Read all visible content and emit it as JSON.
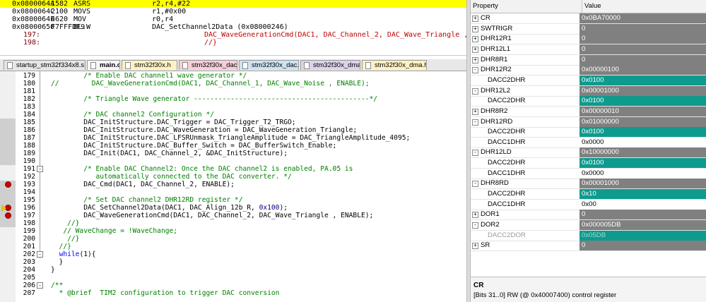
{
  "disassembly": [
    {
      "addr": "0x0800064A",
      "hex": "1582",
      "mn": "ASRS",
      "ops": "r2,r4,#22",
      "hl": true
    },
    {
      "addr": "0x0800064C",
      "hex": "2100",
      "mn": "MOVS",
      "ops": "r1,#0x00"
    },
    {
      "addr": "0x0800064E",
      "hex": "4620",
      "mn": "MOV",
      "ops": "r0,r4"
    },
    {
      "addr": "0x08000650",
      "hex": "F7FFFDF9",
      "mn": "BL.W",
      "ops": "DAC_SetChannel2Data (0x08000246)"
    },
    {
      "src_line": "197:",
      "src": "DAC_WaveGenerationCmd(DAC1, DAC_Channel_2, DAC_Wave_Triangle ,"
    },
    {
      "src_line": "198:",
      "src": "//}"
    }
  ],
  "tabs": [
    {
      "label": "startup_stm32f334x8.s",
      "color": "#e6e6e6"
    },
    {
      "label": "main.c",
      "color": "#f7f7f7",
      "active": true
    },
    {
      "label": "stm32f30x.h",
      "color": "#fff2c2"
    },
    {
      "label": "stm32f30x_dac.h",
      "color": "#f6cfd9"
    },
    {
      "label": "stm32f30x_dac.c",
      "color": "#cde3f3"
    },
    {
      "label": "stm32f30x_dma.c",
      "color": "#dcd3ea"
    },
    {
      "label": "stm32f30x_dma.h",
      "color": "#fff2c2"
    }
  ],
  "editor_lines": [
    {
      "n": "179",
      "segs": [
        [
          "cmt",
          "        /* Enable DAC channel1 wave generator */"
        ]
      ]
    },
    {
      "n": "180",
      "segs": [
        [
          "cmt",
          "//        DAC_WaveGenerationCmd(DAC1, DAC_Channel_1, DAC_Wave_Noise , ENABLE);"
        ]
      ]
    },
    {
      "n": "181",
      "segs": []
    },
    {
      "n": "182",
      "segs": [
        [
          "cmt",
          "        /* Triangle Wave generator -------------------------------------------*/"
        ]
      ]
    },
    {
      "n": "183",
      "segs": []
    },
    {
      "n": "184",
      "segs": [
        [
          "cmt",
          "        /* DAC channel2 Configuration */"
        ]
      ]
    },
    {
      "n": "185",
      "segs": [
        [
          "",
          "        DAC_InitStructure.DAC_Trigger = DAC_Trigger_T2_TRGO;"
        ]
      ]
    },
    {
      "n": "186",
      "segs": [
        [
          "",
          "        DAC_InitStructure.DAC_WaveGeneration = DAC_WaveGeneration_Triangle;"
        ]
      ]
    },
    {
      "n": "187",
      "segs": [
        [
          "",
          "        DAC_InitStructure.DAC_LFSRUnmask_TriangleAmplitude = DAC_TriangleAmplitude_4095;"
        ]
      ]
    },
    {
      "n": "188",
      "segs": [
        [
          "",
          "        DAC_InitStructure.DAC_Buffer_Switch = DAC_BufferSwitch_Enable;"
        ]
      ]
    },
    {
      "n": "189",
      "segs": [
        [
          "",
          "        DAC_Init(DAC1, DAC_Channel_2, &DAC_InitStructure);"
        ]
      ]
    },
    {
      "n": "190",
      "segs": []
    },
    {
      "n": "191",
      "segs": [
        [
          "cmt",
          "        /* Enable DAC Channel2: Once the DAC channel2 is enabled, PA.05 is"
        ]
      ],
      "fold": "-"
    },
    {
      "n": "192",
      "segs": [
        [
          "cmt",
          "           automatically connected to the DAC converter. */"
        ]
      ]
    },
    {
      "n": "193",
      "segs": [
        [
          "",
          "        DAC_Cmd(DAC1, DAC_Channel_2, ENABLE);"
        ]
      ],
      "bp": true
    },
    {
      "n": "194",
      "segs": []
    },
    {
      "n": "195",
      "segs": [
        [
          "cmt",
          "        /* Set DAC channel2 DHR12RD register */"
        ]
      ]
    },
    {
      "n": "196",
      "segs": [
        [
          "",
          "        DAC_SetChannel2Data(DAC1, DAC_Align_12b_R, "
        ],
        [
          "num",
          "0x100"
        ],
        [
          "",
          ");"
        ]
      ],
      "bp": true,
      "pc": true
    },
    {
      "n": "197",
      "segs": [
        [
          "",
          "        DAC_WaveGenerationCmd(DAC1, DAC_Channel_2, DAC_Wave_Triangle , ENABLE);"
        ]
      ],
      "bp": true
    },
    {
      "n": "198",
      "segs": [
        [
          "cmt",
          "    //}"
        ]
      ]
    },
    {
      "n": "199",
      "segs": [
        [
          "cmt",
          "   // WaveChange = !WaveChange;"
        ]
      ]
    },
    {
      "n": "200",
      "segs": [
        [
          "cmt",
          "    //}"
        ]
      ]
    },
    {
      "n": "201",
      "segs": [
        [
          "cmt",
          "  //}"
        ]
      ]
    },
    {
      "n": "202",
      "segs": [
        [
          "",
          "  "
        ],
        [
          "kw",
          "while"
        ],
        [
          "",
          "(1){"
        ]
      ],
      "fold": "-"
    },
    {
      "n": "203",
      "segs": [
        [
          "",
          "  }"
        ]
      ]
    },
    {
      "n": "204",
      "segs": [
        [
          "",
          "}"
        ]
      ]
    },
    {
      "n": "205",
      "segs": []
    },
    {
      "n": "206",
      "segs": [
        [
          "cmt",
          "/**"
        ]
      ],
      "fold": "-"
    },
    {
      "n": "207",
      "segs": [
        [
          "cmt",
          "  * @brief  TIM2 configuration to trigger DAC conversion"
        ]
      ]
    }
  ],
  "properties": {
    "col_property": "Property",
    "col_value": "Value",
    "rows": [
      {
        "name": "CR",
        "value": "0x0BA70000",
        "exp": "+",
        "style": "gray"
      },
      {
        "name": "SWTRIGR",
        "value": "0",
        "exp": "+",
        "style": "gray"
      },
      {
        "name": "DHR12R1",
        "value": "0",
        "exp": "+",
        "style": "gray"
      },
      {
        "name": "DHR12L1",
        "value": "0",
        "exp": "+",
        "style": "gray"
      },
      {
        "name": "DHR8R1",
        "value": "0",
        "exp": "+",
        "style": "gray"
      },
      {
        "name": "DHR12R2",
        "value": "0x00000100",
        "exp": "-",
        "style": "gray"
      },
      {
        "name": "DACC2DHR",
        "value": "0x0100",
        "child": true,
        "style": "teal"
      },
      {
        "name": "DHR12L2",
        "value": "0x00001000",
        "exp": "-",
        "style": "gray"
      },
      {
        "name": "DACC2DHR",
        "value": "0x0100",
        "child": true,
        "style": "teal"
      },
      {
        "name": "DHR8R2",
        "value": "0x00000010",
        "exp": "+",
        "style": "gray"
      },
      {
        "name": "DHR12RD",
        "value": "0x01000000",
        "exp": "-",
        "style": "gray"
      },
      {
        "name": "DACC2DHR",
        "value": "0x0100",
        "child": true,
        "style": "teal"
      },
      {
        "name": "DACC1DHR",
        "value": "0x0000",
        "child": true,
        "style": "white"
      },
      {
        "name": "DHR12LD",
        "value": "0x10000000",
        "exp": "-",
        "style": "gray"
      },
      {
        "name": "DACC2DHR",
        "value": "0x0100",
        "child": true,
        "style": "teal"
      },
      {
        "name": "DACC1DHR",
        "value": "0x0000",
        "child": true,
        "style": "white"
      },
      {
        "name": "DHR8RD",
        "value": "0x00001000",
        "exp": "-",
        "style": "gray"
      },
      {
        "name": "DACC2DHR",
        "value": "0x10",
        "child": true,
        "style": "teal"
      },
      {
        "name": "DACC1DHR",
        "value": "0x00",
        "child": true,
        "style": "white"
      },
      {
        "name": "DOR1",
        "value": "0",
        "exp": "+",
        "style": "gray"
      },
      {
        "name": "DOR2",
        "value": "0x000005DB",
        "exp": "-",
        "style": "gray"
      },
      {
        "name": "DACC2DOR",
        "value": "0x05DB",
        "child": true,
        "style": "teal",
        "dim": true
      },
      {
        "name": "SR",
        "value": "0",
        "exp": "+",
        "style": "gray"
      }
    ],
    "desc_title": "CR",
    "desc_text": "[Bits 31..0] RW (@ 0x40007400) control register"
  }
}
